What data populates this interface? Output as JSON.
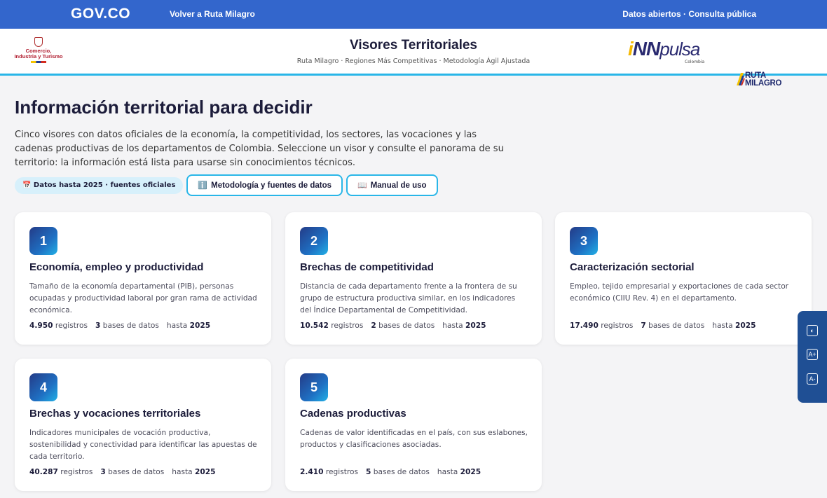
{
  "govbar": {
    "logo": "GOV.CO",
    "back_link": "Volver a Ruta Milagro",
    "right_text": "Datos abiertos · Consulta pública"
  },
  "header": {
    "ministry_logo_text": "Comercio, Industria y Turismo",
    "title": "Visores Territoriales",
    "subtitle": "Ruta Milagro · Regiones Más Competitivas · Metodología Ágil Ajustada",
    "innpulsa_logo": "iNNpulsa",
    "innpulsa_sub": "Colombia",
    "ruta_logo_line1": "RUTA",
    "ruta_logo_line2": "MILAGRO"
  },
  "main": {
    "title": "Información territorial para decidir",
    "intro": "Cinco visores con datos oficiales de la economía, la competitividad, los sectores, las vocaciones y las cadenas productivas de los departamentos de Colombia. Seleccione un visor y consulte el panorama de su territorio: la información está lista para usarse sin conocimientos técnicos.",
    "pill": "📅 Datos hasta 2025 · fuentes oficiales",
    "methodology_button": "Metodología y fuentes de datos",
    "manual_button": "Manual de uso"
  },
  "cards": [
    {
      "number": "1",
      "title": "Economía, empleo y productividad",
      "description": "Tamaño de la economía departamental (PIB), personas ocupadas y productividad laboral por gran rama de actividad económica.",
      "records": "4.950",
      "records_label": "registros",
      "databases": "3",
      "databases_label": "bases de datos",
      "until_label": "hasta",
      "year": "2025"
    },
    {
      "number": "2",
      "title": "Brechas de competitividad",
      "description": "Distancia de cada departamento frente a la frontera de su grupo de estructura productiva similar, en los indicadores del Índice Departamental de Competitividad.",
      "records": "10.542",
      "records_label": "registros",
      "databases": "2",
      "databases_label": "bases de datos",
      "until_label": "hasta",
      "year": "2025"
    },
    {
      "number": "3",
      "title": "Caracterización sectorial",
      "description": "Empleo, tejido empresarial y exportaciones de cada sector económico (CIIU Rev. 4) en el departamento.",
      "records": "17.490",
      "records_label": "registros",
      "databases": "7",
      "databases_label": "bases de datos",
      "until_label": "hasta",
      "year": "2025"
    },
    {
      "number": "4",
      "title": "Brechas y vocaciones territoriales",
      "description": "Indicadores municipales de vocación productiva, sostenibilidad y conectividad para identificar las apuestas de cada territorio.",
      "records": "40.287",
      "records_label": "registros",
      "databases": "3",
      "databases_label": "bases de datos",
      "until_label": "hasta",
      "year": "2025"
    },
    {
      "number": "5",
      "title": "Cadenas productivas",
      "description": "Cadenas de valor identificadas en el país, con sus eslabones, productos y clasificaciones asociadas.",
      "records": "2.410",
      "records_label": "registros",
      "databases": "5",
      "databases_label": "bases de datos",
      "until_label": "hasta",
      "year": "2025"
    }
  ],
  "accessibility": {
    "contrast_icon": "contrast-icon",
    "font_increase": "A+",
    "font_decrease": "A-"
  }
}
